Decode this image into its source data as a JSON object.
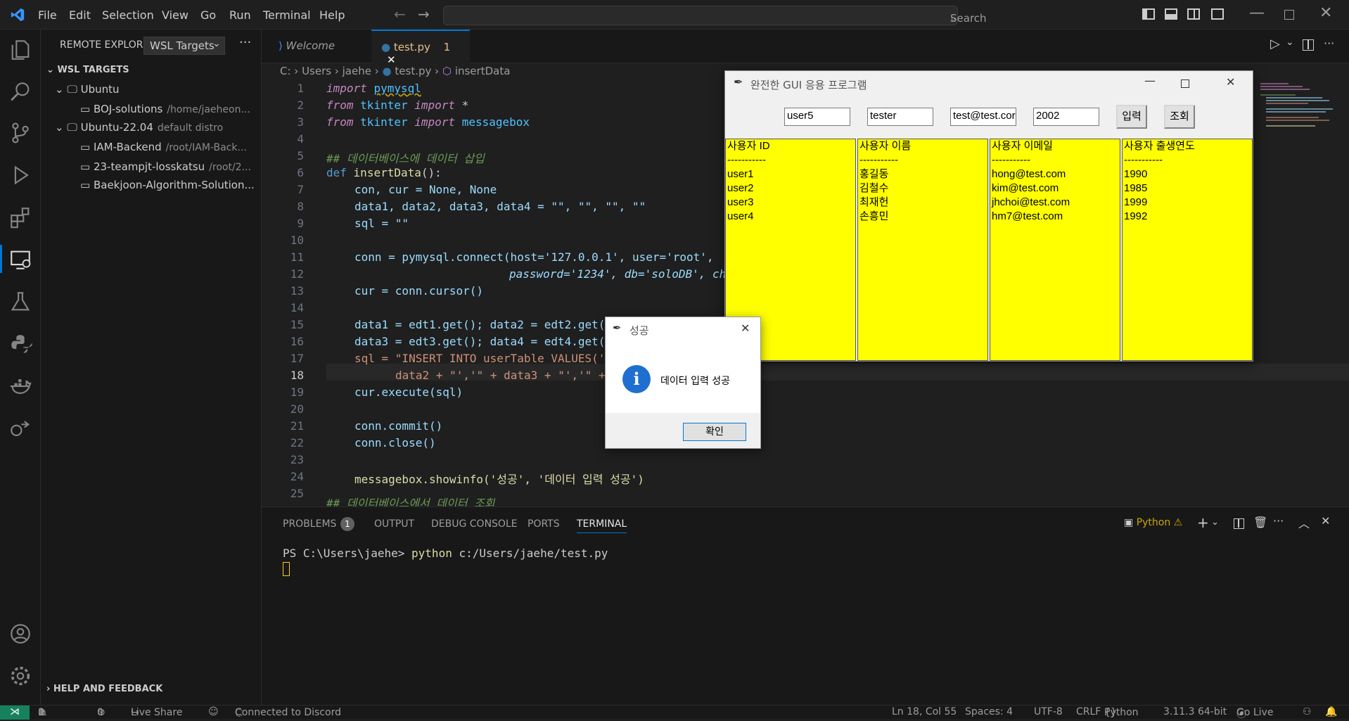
{
  "menu": [
    "File",
    "Edit",
    "Selection",
    "View",
    "Go",
    "Run",
    "Terminal",
    "Help"
  ],
  "search": {
    "placeholder": "Search"
  },
  "sidebar": {
    "title": "REMOTE EXPLOR...",
    "dropdown": "WSL Targets",
    "section": "WSL TARGETS",
    "items": [
      {
        "label": "Ubuntu",
        "sub": ""
      },
      {
        "label": "BOJ-solutions",
        "sub": "/home/jaeheon..."
      },
      {
        "label": "Ubuntu-22.04",
        "sub": "default distro"
      },
      {
        "label": "IAM-Backend",
        "sub": "/root/IAM-Back..."
      },
      {
        "label": "23-teampjt-losskatsu",
        "sub": "/root/2..."
      },
      {
        "label": "Baekjoon-Algorithm-Solution...",
        "sub": ""
      }
    ],
    "help": "HELP AND FEEDBACK"
  },
  "tabs": {
    "welcome": "Welcome",
    "active": "test.py",
    "active_badge": "1"
  },
  "breadcrumb": [
    "C:",
    "Users",
    "jaehe",
    "test.py",
    "insertData"
  ],
  "code": {
    "lines": [
      "1",
      "2",
      "3",
      "4",
      "5",
      "6",
      "7",
      "8",
      "9",
      "10",
      "11",
      "12",
      "13",
      "14",
      "15",
      "16",
      "17",
      "18",
      "19",
      "20",
      "21",
      "22",
      "23",
      "24",
      "25"
    ],
    "l1a": "import",
    "l1b": "pymysql",
    "l2a": "from",
    "l2b": "tkinter",
    "l2c": "import",
    "l2d": "*",
    "l3a": "from",
    "l3b": "tkinter",
    "l3c": "import",
    "l3d": "messagebox",
    "l5": "## 데이터베이스에 데이터 삽입",
    "l6a": "def",
    "l6b": "insertData",
    "l7": "con, cur = None, None",
    "l8": "data1, data2, data3, data4 = \"\", \"\", \"\", \"\"",
    "l9": "sql = \"\"",
    "l11": "conn = pymysql.connect(host='127.0.0.1', user='root',",
    "l12": "password='1234', db='soloDB', ch",
    "l13": "cur = conn.cursor()",
    "l15": "data1 = edt1.get(); data2 = edt2.get(",
    "l16": "data3 = edt3.get(); data4 = edt4.get(",
    "l17": "sql = \"INSERT INTO userTable VALUES('",
    "l18": "data2 + \"','\" + data3 + \"','\" +",
    "l19": "cur.execute(sql)",
    "l21": "conn.commit()",
    "l22": "conn.close()",
    "l24": "messagebox.showinfo('성공', '데이터 입력 성공')",
    "l25": "## 데이터베이스에서 데이터 조회"
  },
  "panel": {
    "tabs": [
      "PROBLEMS",
      "OUTPUT",
      "DEBUG CONSOLE",
      "PORTS",
      "TERMINAL"
    ],
    "problems_count": "1",
    "terminal_label": "Python",
    "prompt": "PS C:\\Users\\jaehe>",
    "cmd": "python",
    "path": "c:/Users/jaehe/test.py"
  },
  "status": {
    "errors": "0",
    "warnings": "1",
    "ports": "0",
    "liveshare": "Live Share",
    "discord": "Connected to Discord",
    "position": "Ln 18, Col 55",
    "spaces": "Spaces: 4",
    "encoding": "UTF-8",
    "eol": "CRLF",
    "lang": "Python",
    "version": "3.11.3 64-bit",
    "golive": "Go Live"
  },
  "tk": {
    "title": "완전한 GUI 응용 프로그램",
    "entries": [
      "user5",
      "tester",
      "test@test.cor",
      "2002"
    ],
    "btn_insert": "입력",
    "btn_query": "조회",
    "col1": [
      "사용자 ID",
      "-----------",
      "user1",
      "user2",
      "user3",
      "user4"
    ],
    "col2": [
      "사용자 이름",
      "-----------",
      "홍길동",
      "김철수",
      "최재헌",
      "손흥민"
    ],
    "col3": [
      "사용자 이메일",
      "-----------",
      "hong@test.com",
      "kim@test.com",
      "jhchoi@test.com",
      "hm7@test.com"
    ],
    "col4": [
      "사용자 출생연도",
      "-----------",
      "1990",
      "1985",
      "1999",
      "1992"
    ]
  },
  "msgbox": {
    "title": "성공",
    "message": "데이터 입력 성공",
    "ok": "확인"
  }
}
